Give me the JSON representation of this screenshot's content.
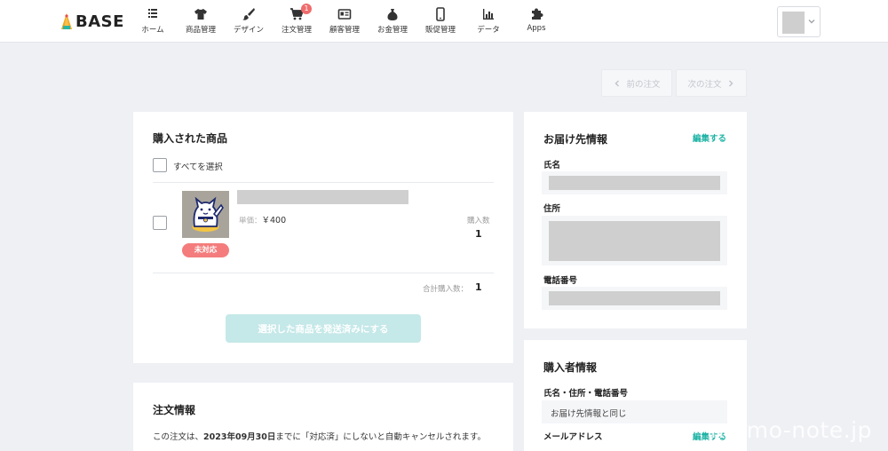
{
  "header": {
    "brand": "BASE",
    "nav": [
      {
        "label": "ホーム",
        "icon": "home-list-icon"
      },
      {
        "label": "商品管理",
        "icon": "tshirt-icon"
      },
      {
        "label": "デザイン",
        "icon": "brush-icon"
      },
      {
        "label": "注文管理",
        "icon": "cart-icon",
        "badge": "1"
      },
      {
        "label": "顧客管理",
        "icon": "customer-card-icon"
      },
      {
        "label": "お金管理",
        "icon": "money-bag-icon"
      },
      {
        "label": "販促管理",
        "icon": "smartphone-icon"
      },
      {
        "label": "データ",
        "icon": "bar-chart-icon"
      },
      {
        "label": "Apps",
        "icon": "puzzle-icon"
      }
    ]
  },
  "pager": {
    "prev": "前の注文",
    "next": "次の注文"
  },
  "purchased": {
    "title": "購入された商品",
    "select_all": "すべてを選択",
    "item": {
      "unit_price_label": "単価：",
      "unit_price": "￥400",
      "qty_label": "購入数",
      "qty": "1",
      "status": "未対応"
    },
    "total_label": "合計購入数：",
    "total": "1",
    "ship_button": "選択した商品を発送済みにする"
  },
  "order_info": {
    "title": "注文情報",
    "notice_prefix": "この注文は、",
    "notice_date": "2023年09月30日",
    "notice_suffix": "までに「対応済」にしないと自動キャンセルされます。"
  },
  "delivery": {
    "title": "お届け先情報",
    "edit": "編集する",
    "name_label": "氏名",
    "address_label": "住所",
    "phone_label": "電話番号"
  },
  "buyer": {
    "title": "購入者情報",
    "contact_label": "氏名・住所・電話番号",
    "contact_value": "お届け先情報と同じ",
    "email_label": "メールアドレス",
    "edit": "編集する"
  },
  "watermark": "memo-note.jp"
}
